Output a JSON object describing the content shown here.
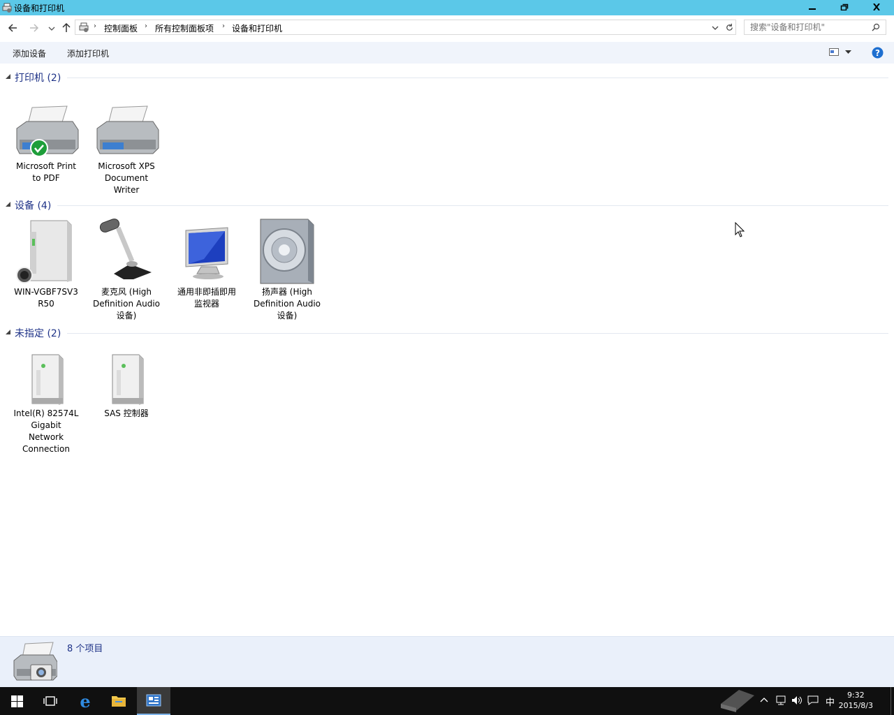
{
  "window": {
    "title": "设备和打印机"
  },
  "nav": {
    "breadcrumb": [
      "控制面板",
      "所有控制面板项",
      "设备和打印机"
    ],
    "search_placeholder": "搜索\"设备和打印机\""
  },
  "commands": {
    "add_device": "添加设备",
    "add_printer": "添加打印机"
  },
  "groups": [
    {
      "label": "打印机 (2)",
      "items": [
        {
          "name": [
            "Microsoft Print",
            "to PDF"
          ]
        },
        {
          "name": [
            "Microsoft XPS",
            "Document",
            "Writer"
          ]
        }
      ]
    },
    {
      "label": "设备 (4)",
      "items": [
        {
          "name": [
            "WIN-VGBF7SV3",
            "R50"
          ]
        },
        {
          "name": [
            "麦克风 (High",
            "Definition Audio",
            "设备)"
          ]
        },
        {
          "name": [
            "通用非即插即用",
            "监视器"
          ]
        },
        {
          "name": [
            "扬声器 (High",
            "Definition Audio",
            "设备)"
          ]
        }
      ]
    },
    {
      "label": "未指定 (2)",
      "items": [
        {
          "name": [
            "Intel(R) 82574L",
            "Gigabit",
            "Network",
            "Connection"
          ]
        },
        {
          "name": [
            "SAS 控制器"
          ]
        }
      ]
    }
  ],
  "details": {
    "count": "8 个项目"
  },
  "taskbar": {
    "time": "9:32",
    "date": "2015/8/3",
    "ime": "中"
  },
  "colors": {
    "titlebar": "#5bc8e8",
    "accent_text": "#1e3287",
    "taskbar": "#101010"
  }
}
